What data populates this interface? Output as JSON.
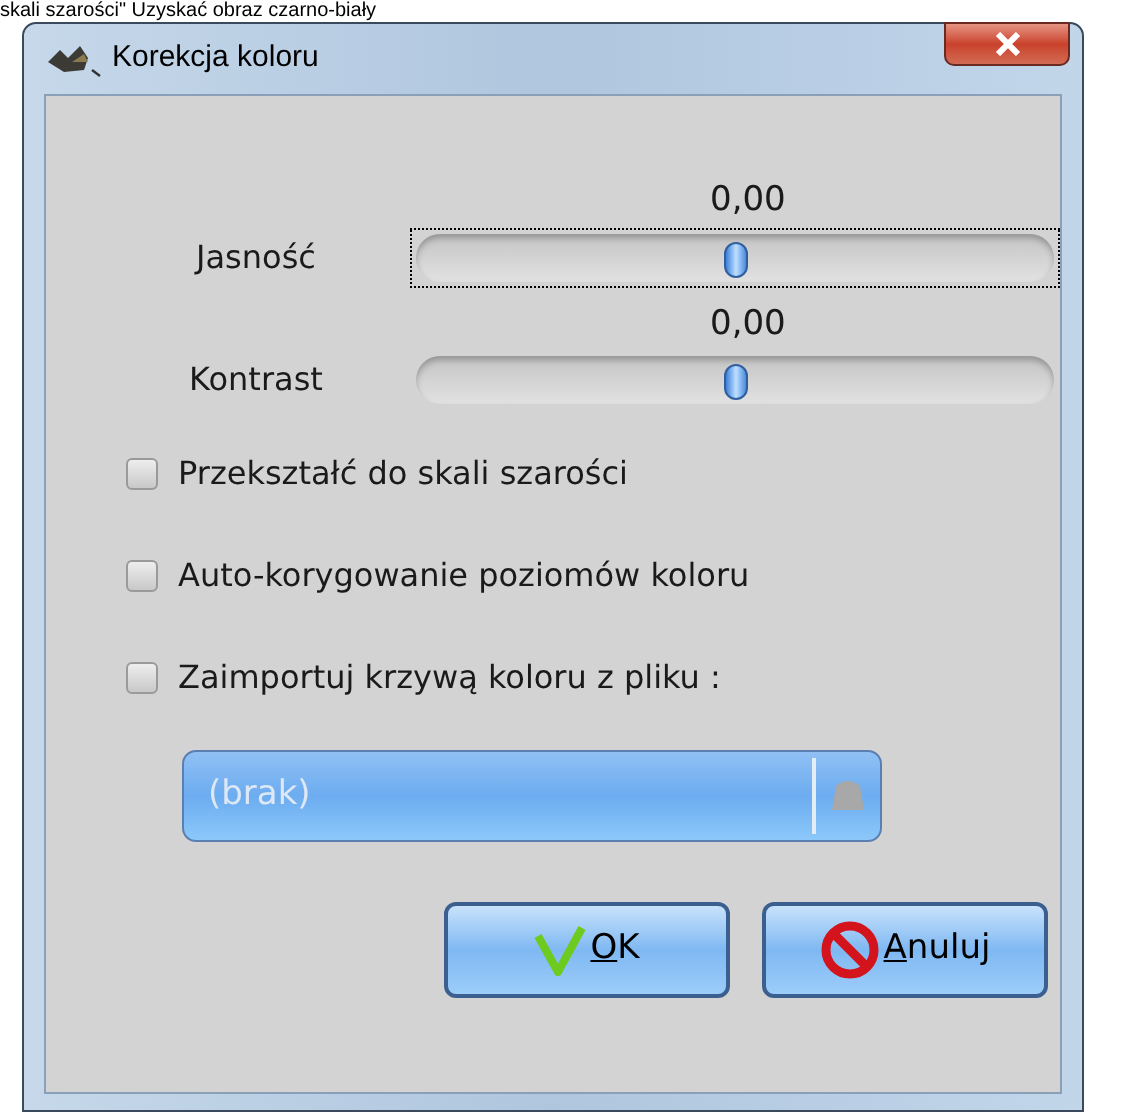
{
  "background_text": "skali szarości\" Uzyskać obraz czarno-biały",
  "window": {
    "title": "Korekcja koloru"
  },
  "sliders": [
    {
      "label": "Jasność",
      "reading": "0,00",
      "level": 0.5,
      "focused": true
    },
    {
      "label": "Kontrast",
      "reading": "0,00",
      "level": 0.5,
      "focused": false
    }
  ],
  "checkboxes": [
    {
      "label": "Przekształć do skali szarości",
      "checked": false
    },
    {
      "label": "Auto-korygowanie poziomów koloru",
      "checked": false
    },
    {
      "label": "Zaimportuj krzywą koloru z pliku :",
      "checked": false
    }
  ],
  "file_dropdown": {
    "value": "(brak)",
    "disabled": true
  },
  "buttons": [
    {
      "kind": "ok",
      "label": "OK"
    },
    {
      "kind": "cancel",
      "label": "Anuluj"
    }
  ]
}
